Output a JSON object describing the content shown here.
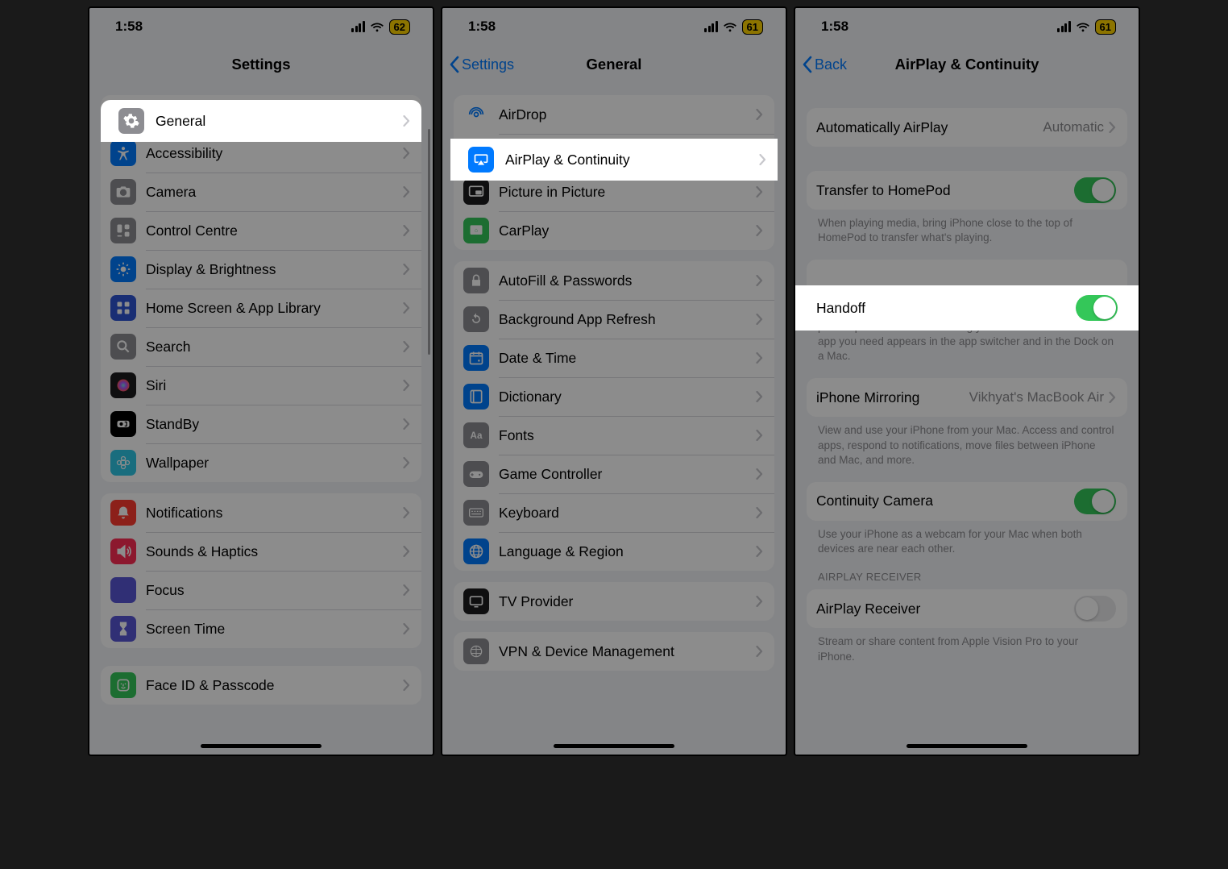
{
  "status": {
    "time": "1:58",
    "battery1": "62",
    "battery2": "61",
    "battery3": "61"
  },
  "screen1": {
    "title": "Settings",
    "rows_a": [
      {
        "name": "general",
        "label": "General",
        "bg": "#8d8d92"
      },
      {
        "name": "accessibility",
        "label": "Accessibility",
        "bg": "#007aff"
      },
      {
        "name": "camera",
        "label": "Camera",
        "bg": "#8d8d92"
      },
      {
        "name": "control-centre",
        "label": "Control Centre",
        "bg": "#8d8d92"
      },
      {
        "name": "display",
        "label": "Display & Brightness",
        "bg": "#007aff"
      },
      {
        "name": "home-screen",
        "label": "Home Screen & App Library",
        "bg": "#2f55d4"
      },
      {
        "name": "search",
        "label": "Search",
        "bg": "#8d8d92"
      },
      {
        "name": "siri",
        "label": "Siri",
        "bg": "#1c1c1e"
      },
      {
        "name": "standby",
        "label": "StandBy",
        "bg": "#000000"
      },
      {
        "name": "wallpaper",
        "label": "Wallpaper",
        "bg": "#2ec6e6"
      }
    ],
    "rows_b": [
      {
        "name": "notifications",
        "label": "Notifications",
        "bg": "#ff3b30"
      },
      {
        "name": "sounds",
        "label": "Sounds & Haptics",
        "bg": "#ff2d55"
      },
      {
        "name": "focus",
        "label": "Focus",
        "bg": "#5856d6"
      },
      {
        "name": "screen-time",
        "label": "Screen Time",
        "bg": "#5856d6"
      }
    ],
    "rows_c": [
      {
        "name": "faceid",
        "label": "Face ID & Passcode",
        "bg": "#34c759"
      }
    ]
  },
  "screen2": {
    "back": "Settings",
    "title": "General",
    "rows_a": [
      {
        "name": "airdrop",
        "label": "AirDrop",
        "bg": "#ffffff",
        "fg": "#007aff"
      },
      {
        "name": "airplay",
        "label": "AirPlay & Continuity",
        "bg": "#007aff"
      },
      {
        "name": "pip",
        "label": "Picture in Picture",
        "bg": "#1c1c1e"
      },
      {
        "name": "carplay",
        "label": "CarPlay",
        "bg": "#34c759"
      }
    ],
    "rows_b": [
      {
        "name": "autofill",
        "label": "AutoFill & Passwords",
        "bg": "#8d8d92"
      },
      {
        "name": "bgrefresh",
        "label": "Background App Refresh",
        "bg": "#8d8d92"
      },
      {
        "name": "datetime",
        "label": "Date & Time",
        "bg": "#007aff"
      },
      {
        "name": "dictionary",
        "label": "Dictionary",
        "bg": "#007aff"
      },
      {
        "name": "fonts",
        "label": "Fonts",
        "bg": "#8d8d92"
      },
      {
        "name": "gamectrl",
        "label": "Game Controller",
        "bg": "#8d8d92"
      },
      {
        "name": "keyboard",
        "label": "Keyboard",
        "bg": "#8d8d92"
      },
      {
        "name": "language",
        "label": "Language & Region",
        "bg": "#007aff"
      }
    ],
    "rows_c": [
      {
        "name": "tvprovider",
        "label": "TV Provider",
        "bg": "#1c1c1e"
      }
    ],
    "rows_d": [
      {
        "name": "vpn",
        "label": "VPN & Device Management",
        "bg": "#8d8d92"
      }
    ]
  },
  "screen3": {
    "back": "Back",
    "title": "AirPlay & Continuity",
    "auto_row": {
      "label": "Automatically AirPlay",
      "value": "Automatic"
    },
    "transfer": {
      "label": "Transfer to HomePod",
      "on": true
    },
    "transfer_footer": "When playing media, bring iPhone close to the top of HomePod to transfer what's playing.",
    "handoff": {
      "label": "Handoff",
      "on": true
    },
    "handoff_footer": "Handoff lets you start something on one device and instantly pick it up on other devices using your iCloud account. The app you need appears in the app switcher and in the Dock on a Mac.",
    "mirroring": {
      "label": "iPhone Mirroring",
      "value": "Vikhyat's MacBook Air"
    },
    "mirroring_footer": "View and use your iPhone from your Mac. Access and control apps, respond to notifications, move files between iPhone and Mac, and more.",
    "continuity": {
      "label": "Continuity Camera",
      "on": true
    },
    "continuity_footer": "Use your iPhone as a webcam for your Mac when both devices are near each other.",
    "receiver_header": "AIRPLAY RECEIVER",
    "receiver": {
      "label": "AirPlay Receiver",
      "on": false
    },
    "receiver_footer": "Stream or share content from Apple Vision Pro to your iPhone."
  }
}
